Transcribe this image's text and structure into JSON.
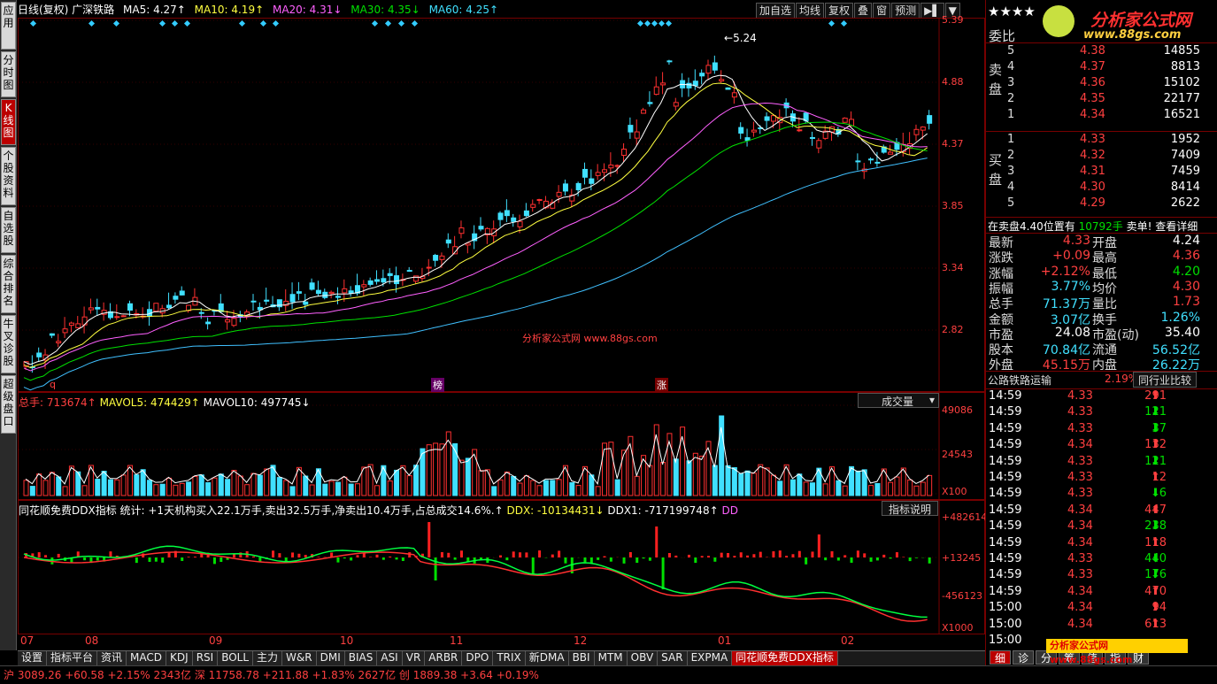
{
  "nav": [
    "应用",
    "分时图",
    "K线图",
    "个股资料",
    "自选股",
    "综合排名",
    "牛叉诊股",
    "超级盘口"
  ],
  "header": {
    "title": "日线(复权) 广深铁路",
    "ma5": "MA5: 4.27↑",
    "ma10": "MA10: 4.19↑",
    "ma20": "MA20: 4.31↓",
    "ma30": "MA30: 4.35↓",
    "ma60": "MA60: 4.25↑"
  },
  "tools": [
    "加自选",
    "均线",
    "复权",
    "叠",
    "窗",
    "预测",
    "▶▌",
    "▼"
  ],
  "price_axis": [
    "5.39",
    "4.88",
    "4.37",
    "3.85",
    "3.34",
    "2.82"
  ],
  "peak_label": "5.24",
  "watermark": "分析家公式网 www.88gs.com",
  "markers": {
    "q": "q",
    "bang": "榜",
    "zhang": "涨"
  },
  "volume": {
    "label": "总手: 713674↑",
    "mavol5": "MAVOL5: 474429↑",
    "mavol10": "MAVOL10: 497745↓",
    "selector": "成交量",
    "axis": [
      "49086",
      "24543",
      "X100"
    ]
  },
  "ddx": {
    "label": "同花顺免费DDX指标 统计: +1天机构买入22.1万手,卖出32.5万手,净卖出10.4万手,占总成交14.6%.↑",
    "ddx": "DDX: -10134431↓",
    "ddx1": "DDX1: -717199748↑",
    "ddy": "DD",
    "button": "指标说明",
    "axis": [
      "+482614",
      "+13245",
      "-456123",
      "X1000"
    ]
  },
  "months": [
    "07",
    "08",
    "09",
    "10",
    "11",
    "12",
    "01",
    "02"
  ],
  "bottom_tabs": [
    "设置",
    "指标平台",
    "资讯",
    "MACD",
    "KDJ",
    "RSI",
    "BOLL",
    "主力",
    "W&R",
    "DMI",
    "BIAS",
    "ASI",
    "VR",
    "ARBR",
    "DPO",
    "TRIX",
    "新DMA",
    "BBI",
    "MTM",
    "OBV",
    "SAR",
    "EXPMA",
    "同花顺免费DDX指标"
  ],
  "right": {
    "logo_stars": "★★★★",
    "logo_text": "分析家公式网",
    "logo_url": "www.88gs.com",
    "weibi": "委比",
    "sell_label": "卖盘",
    "buy_label": "买盘",
    "asks": [
      [
        "5",
        "4.38",
        "14855"
      ],
      [
        "4",
        "4.37",
        "8813"
      ],
      [
        "3",
        "4.36",
        "15102"
      ],
      [
        "2",
        "4.35",
        "22177"
      ],
      [
        "1",
        "4.34",
        "16521"
      ]
    ],
    "bids": [
      [
        "1",
        "4.33",
        "1952"
      ],
      [
        "2",
        "4.32",
        "7409"
      ],
      [
        "3",
        "4.31",
        "7459"
      ],
      [
        "4",
        "4.30",
        "8414"
      ],
      [
        "5",
        "4.29",
        "2622"
      ]
    ],
    "notice": "在卖盘4.40位置有",
    "notice2": "10792手",
    "notice3": "卖单!",
    "notice4": "查看详细",
    "stats": [
      [
        "最新",
        "4.33",
        "开盘",
        "4.24"
      ],
      [
        "涨跌",
        "+0.09",
        "最高",
        "4.36"
      ],
      [
        "涨幅",
        "+2.12%",
        "最低",
        "4.20"
      ],
      [
        "振幅",
        "3.77%",
        "均价",
        "4.30"
      ],
      [
        "总手",
        "71.37万",
        "量比",
        "1.73"
      ],
      [
        "金额",
        "3.07亿",
        "换手",
        "1.26%"
      ],
      [
        "市盈",
        "24.08",
        "市盈(动)",
        "35.40"
      ],
      [
        "股本",
        "70.84亿",
        "流通",
        "56.52亿"
      ],
      [
        "外盘",
        "45.15万",
        "内盘",
        "26.22万"
      ]
    ],
    "industry": "公路铁路运输",
    "industry_pct": "2.19%",
    "industry_btn": "同行业比较",
    "ticks": [
      [
        "14:59",
        "4.33",
        "291",
        "up"
      ],
      [
        "14:59",
        "4.33",
        "121",
        "down"
      ],
      [
        "14:59",
        "4.33",
        "37",
        "down"
      ],
      [
        "14:59",
        "4.34",
        "132",
        "up"
      ],
      [
        "14:59",
        "4.33",
        "121",
        "down"
      ],
      [
        "14:59",
        "4.33",
        "12",
        "up"
      ],
      [
        "14:59",
        "4.33",
        "6",
        "down"
      ],
      [
        "14:59",
        "4.34",
        "447",
        "up"
      ],
      [
        "14:59",
        "4.34",
        "238",
        "down"
      ],
      [
        "14:59",
        "4.34",
        "118",
        "up"
      ],
      [
        "14:59",
        "4.33",
        "440",
        "down"
      ],
      [
        "14:59",
        "4.33",
        "176",
        "down"
      ],
      [
        "14:59",
        "4.34",
        "470",
        "up"
      ],
      [
        "15:00",
        "4.34",
        "94",
        "up"
      ],
      [
        "15:00",
        "4.34",
        "613",
        "up"
      ],
      [
        "15:00",
        "",
        "",
        ""
      ]
    ],
    "bottom_tabs": [
      "细",
      "诊",
      "分",
      "筹",
      "值",
      "指",
      "财"
    ],
    "ad": "分析家公式网 www.88gs.com"
  },
  "status": "沪 3089.26 +60.58 +2.15% 2343亿 深 11758.78 +211.88 +1.83% 2627亿 创 1889.38 +3.64 +0.19%",
  "colors": {
    "up": "#ff3030",
    "down": "#40e0ff",
    "ma5": "#ffffff",
    "ma10": "#ffff40",
    "ma20": "#ff60ff",
    "ma30": "#00e000",
    "ma60": "#40c0ff"
  }
}
